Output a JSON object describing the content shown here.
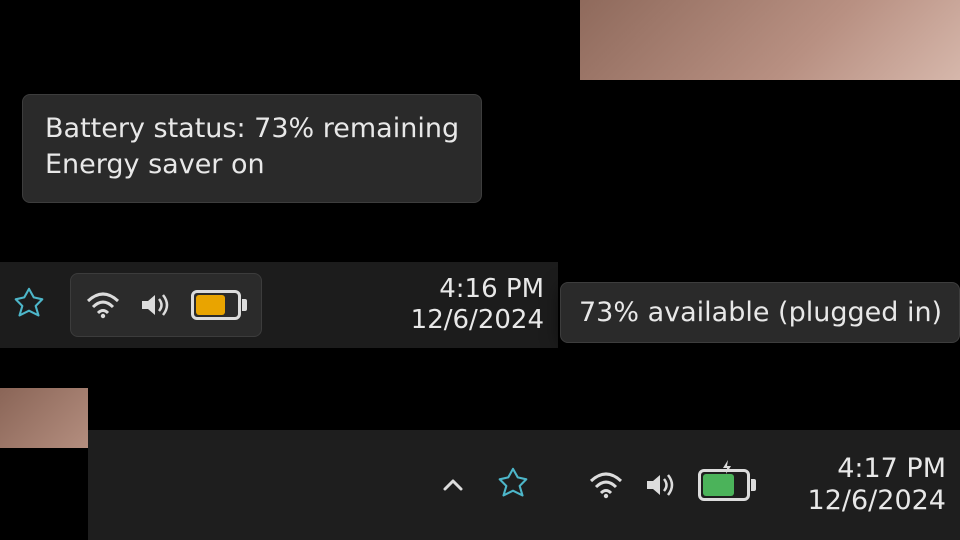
{
  "scenario_saver": {
    "tooltip_line1": "Battery status: 73% remaining",
    "tooltip_line2": "Energy saver on",
    "battery_percent": 73,
    "battery_color": "#e9a400",
    "time": "4:16 PM",
    "date": "12/6/2024"
  },
  "scenario_plugged": {
    "tooltip": "73% available (plugged in)",
    "battery_percent": 73,
    "battery_color": "#4bb35a",
    "time": "4:17 PM",
    "date": "12/6/2024"
  }
}
